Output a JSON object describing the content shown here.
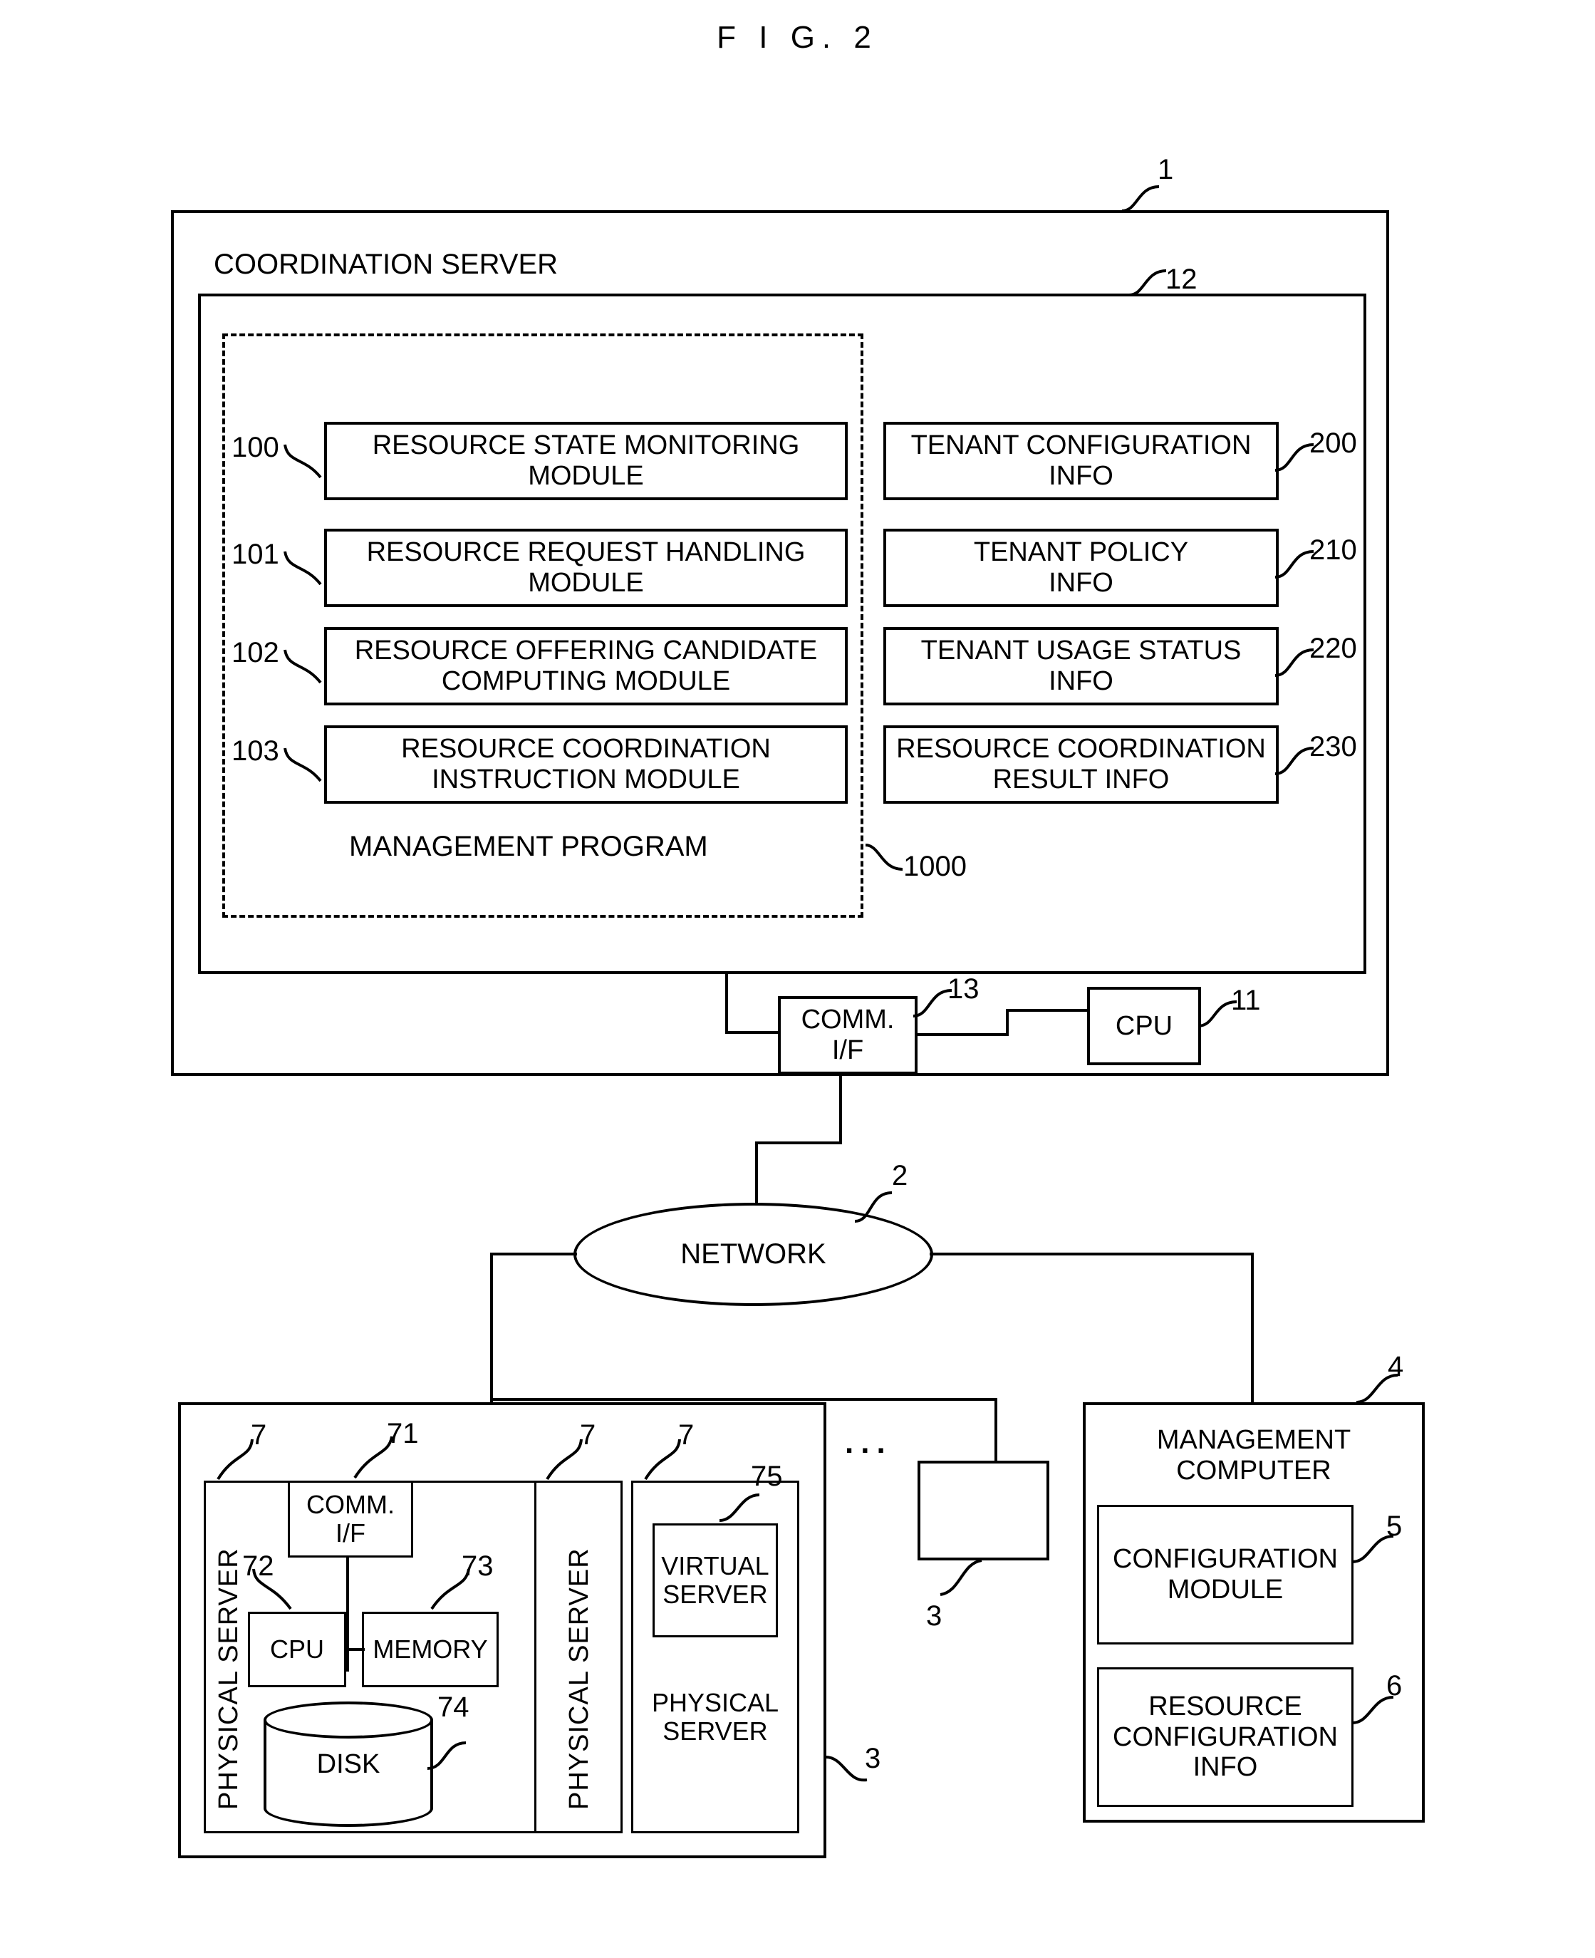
{
  "figure": {
    "title": "F I G. 2"
  },
  "coordination_server": {
    "label": "COORDINATION SERVER",
    "ref": "1",
    "memory": {
      "ref": "12"
    },
    "management_program": {
      "label": "MANAGEMENT PROGRAM",
      "ref": "1000",
      "modules": [
        {
          "ref": "100",
          "line1": "RESOURCE STATE MONITORING",
          "line2": "MODULE"
        },
        {
          "ref": "101",
          "line1": "RESOURCE REQUEST HANDLING",
          "line2": "MODULE"
        },
        {
          "ref": "102",
          "line1": "RESOURCE OFFERING CANDIDATE",
          "line2": "COMPUTING MODULE"
        },
        {
          "ref": "103",
          "line1": "RESOURCE COORDINATION",
          "line2": "INSTRUCTION MODULE"
        }
      ]
    },
    "info_items": [
      {
        "ref": "200",
        "line1": "TENANT CONFIGURATION",
        "line2": "INFO"
      },
      {
        "ref": "210",
        "line1": "TENANT POLICY",
        "line2": "INFO"
      },
      {
        "ref": "220",
        "line1": "TENANT USAGE STATUS",
        "line2": "INFO"
      },
      {
        "ref": "230",
        "line1": "RESOURCE COORDINATION",
        "line2": "RESULT INFO"
      }
    ],
    "comm_if": {
      "ref": "13",
      "line1": "COMM.",
      "line2": "I/F"
    },
    "cpu": {
      "ref": "11",
      "label": "CPU"
    }
  },
  "network": {
    "label": "NETWORK",
    "ref": "2"
  },
  "server_group": {
    "ref": "3",
    "ellipsis": "...",
    "servers": [
      {
        "ref": "7",
        "side_label": "PHYSICAL SERVER",
        "comm_if": {
          "ref": "71",
          "line1": "COMM.",
          "line2": "I/F"
        },
        "cpu": {
          "ref": "72",
          "label": "CPU"
        },
        "memory": {
          "ref": "73",
          "label": "MEMORY"
        },
        "disk": {
          "ref": "74",
          "label": "DISK"
        }
      },
      {
        "ref": "7",
        "side_label": "PHYSICAL SERVER"
      },
      {
        "ref": "7",
        "virtual_server": {
          "ref": "75",
          "line1": "VIRTUAL",
          "line2": "SERVER"
        },
        "bottom_label_line1": "PHYSICAL",
        "bottom_label_line2": "SERVER"
      }
    ],
    "other_node": {
      "ref": "3"
    }
  },
  "management_computer": {
    "ref": "4",
    "line1": "MANAGEMENT",
    "line2": "COMPUTER",
    "configuration_module": {
      "ref": "5",
      "line1": "CONFIGURATION",
      "line2": "MODULE"
    },
    "resource_configuration_info": {
      "ref": "6",
      "line1": "RESOURCE",
      "line2": "CONFIGURATION",
      "line3": "INFO"
    }
  }
}
